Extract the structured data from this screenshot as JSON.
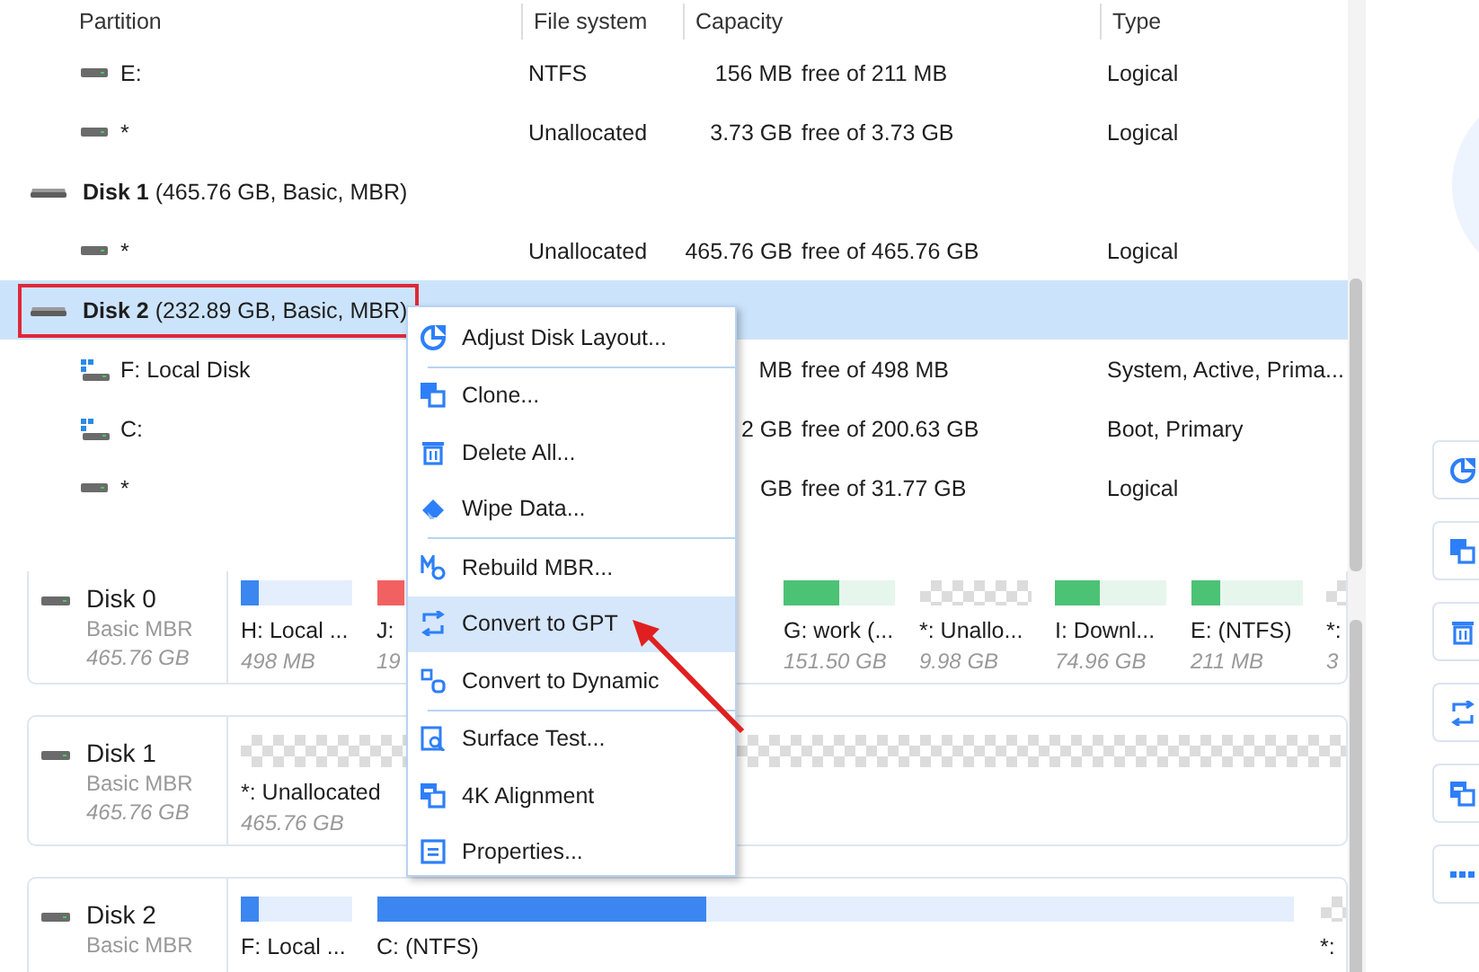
{
  "table": {
    "columns": [
      "Partition",
      "File system",
      "Capacity",
      "Type"
    ],
    "rows": [
      {
        "kind": "partition",
        "label": "E:",
        "fs": "NTFS",
        "used": "156 MB",
        "free": "free of 211 MB",
        "type": "Logical",
        "selected": false
      },
      {
        "kind": "partition",
        "label": "*",
        "fs": "Unallocated",
        "used": "3.73 GB",
        "free": "free of 3.73 GB",
        "type": "Logical",
        "selected": false
      },
      {
        "kind": "disk",
        "label": "**Disk 1** (465.76 GB, Basic, MBR)",
        "selected": false
      },
      {
        "kind": "partition",
        "label": "*",
        "fs": "Unallocated",
        "used": "465.76 GB",
        "free": "free of 465.76 GB",
        "type": "Logical",
        "selected": false
      },
      {
        "kind": "disk",
        "label": "**Disk 2** (232.89 GB, Basic, MBR)",
        "selected": true
      },
      {
        "kind": "system_partition",
        "label": "F: Local Disk",
        "used": "MB",
        "free": "free of 498 MB",
        "type": "System, Active, Prima...",
        "selected": false
      },
      {
        "kind": "system_partition",
        "label": "C:",
        "used": "2 GB",
        "free": "free of 200.63 GB",
        "type": "Boot, Primary",
        "selected": false
      },
      {
        "kind": "partition",
        "label": "*",
        "used": "GB",
        "free": "free of 31.77 GB",
        "type": "Logical",
        "selected": false
      }
    ]
  },
  "disk_map": [
    {
      "name": "Disk 0",
      "style": "Basic MBR",
      "size": "465.76 GB",
      "partitions": [
        {
          "kind": "used",
          "label": "H: Local ...",
          "size": "498 MB",
          "color": "#3b86f0",
          "level": 0.16
        },
        {
          "kind": "used",
          "label": "J:",
          "size": "19",
          "color": "#f26161",
          "level": 0.25
        },
        {
          "kind": "covered"
        },
        {
          "kind": "covered"
        },
        {
          "kind": "used",
          "label": "G: work (...",
          "size": "151.50 GB",
          "color": "#4cc274",
          "level": 0.5
        },
        {
          "kind": "unallocated",
          "label": "*: Unallo...",
          "size": "9.98 GB"
        },
        {
          "kind": "used",
          "label": "I: Downl...",
          "size": "74.96 GB",
          "color": "#4cc274",
          "level": 0.4
        },
        {
          "kind": "used",
          "label": "E:  (NTFS)",
          "size": "211 MB",
          "color": "#4cc274",
          "level": 0.27
        },
        {
          "kind": "unallocated",
          "label": "*:",
          "size": "3"
        }
      ]
    },
    {
      "name": "Disk 1",
      "style": "Basic MBR",
      "size": "465.76 GB",
      "partitions": [
        {
          "kind": "unallocated",
          "label": "*: Unallocated",
          "size": "465.76 GB"
        }
      ]
    },
    {
      "name": "Disk 2",
      "style": "Basic MBR",
      "partitions": [
        {
          "kind": "used",
          "label": "F: Local ...",
          "color": "#3b86f0",
          "level": 0.16
        },
        {
          "kind": "used",
          "label": "C:  (NTFS)",
          "color": "#3b86f0",
          "level": 0.36
        },
        {
          "kind": "unallocated",
          "label": "*:"
        }
      ]
    }
  ],
  "context_menu": {
    "groups": [
      [
        {
          "label": "Adjust Disk Layout...",
          "selected": false
        }
      ],
      [
        {
          "label": "Clone...",
          "selected": false
        },
        {
          "label": "Delete All...",
          "selected": false
        },
        {
          "label": "Wipe Data...",
          "selected": false
        }
      ],
      [
        {
          "label": "Rebuild MBR...",
          "selected": false
        },
        {
          "label": "Convert to GPT",
          "selected": true
        },
        {
          "label": "Convert to Dynamic",
          "selected": false
        }
      ],
      [
        {
          "label": "Surface Test...",
          "selected": false
        },
        {
          "label": "4K Alignment",
          "selected": false
        },
        {
          "label": "Properties...",
          "selected": false
        }
      ]
    ]
  }
}
